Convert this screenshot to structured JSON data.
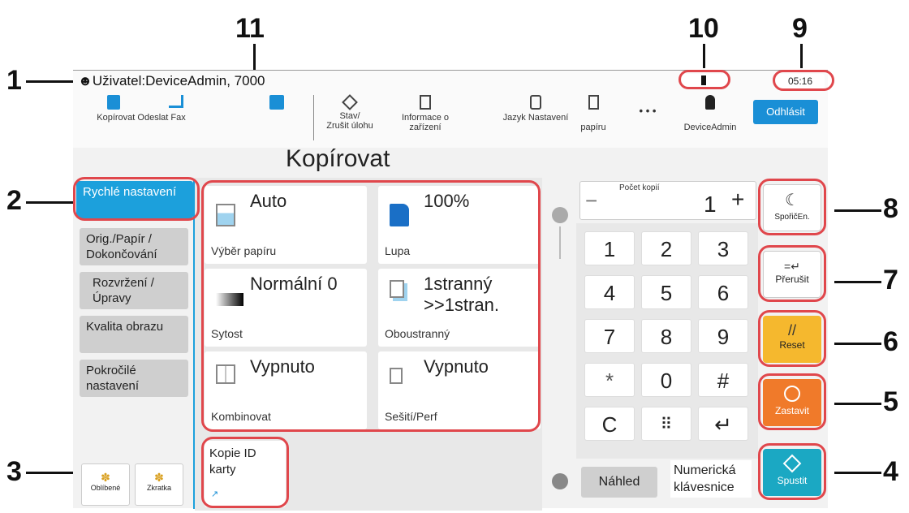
{
  "callouts": [
    "1",
    "2",
    "3",
    "4",
    "5",
    "6",
    "7",
    "8",
    "9",
    "10",
    "11"
  ],
  "user": {
    "text": "Uživatel:DeviceAdmin, 7000"
  },
  "toolbar": {
    "copy_fax": "Kopírovat Odeslat Fax",
    "status_label_1": "Stav/",
    "status_label_2": "Zrušit úlohu",
    "info_label_1": "Informace o",
    "info_label_2": "zařízení",
    "language_label": "Jazyk Nastavení",
    "paper_label": "papíru",
    "more": "• • •",
    "account_label": "DeviceAdmin",
    "logout": "Odhlásit"
  },
  "status": {
    "time": "05:16"
  },
  "page_title": "Kopírovat",
  "sidebar": {
    "items": [
      {
        "label": "Rychlé nastavení"
      },
      {
        "label": "Orig./Papír / Dokončování"
      },
      {
        "label": "Rozvržení /Úpravy"
      },
      {
        "label": "Kvalita obrazu"
      },
      {
        "label": "Pokročilé nastavení"
      }
    ],
    "favorites": "Oblíbené",
    "shortcut": "Zkratka"
  },
  "tiles": [
    {
      "value": "Auto",
      "label": "Výběr papíru"
    },
    {
      "value": "100%",
      "label": "Lupa"
    },
    {
      "value": "Normální 0",
      "label": "Sytost"
    },
    {
      "value": "1stranný >>1stran.",
      "label": "Oboustranný"
    },
    {
      "value": "Vypnuto",
      "label": "Kombinovat"
    },
    {
      "value": "Vypnuto",
      "label": "Sešití/Perf"
    }
  ],
  "id_card": {
    "label": "Kopie ID karty"
  },
  "copies": {
    "label": "Počet kopií",
    "value": "1",
    "minus": "−",
    "plus": "+"
  },
  "keypad": [
    "1",
    "2",
    "3",
    "4",
    "5",
    "6",
    "7",
    "8",
    "9",
    "*",
    "0",
    "#",
    "C",
    "⠿",
    "↵"
  ],
  "preview": "Náhled",
  "numeric_keyboard": "Numerická klávesnice",
  "buttons": {
    "energy_saver": "SpořičEn.",
    "interrupt": "Přerušit",
    "reset": "Reset",
    "stop": "Zastavit",
    "start": "Spustit"
  },
  "colors": {
    "accent": "#1ca0dc",
    "reset": "#f5b82e",
    "stop": "#f07a2a",
    "start": "#1ba8c3",
    "callout": "#e0474c"
  }
}
